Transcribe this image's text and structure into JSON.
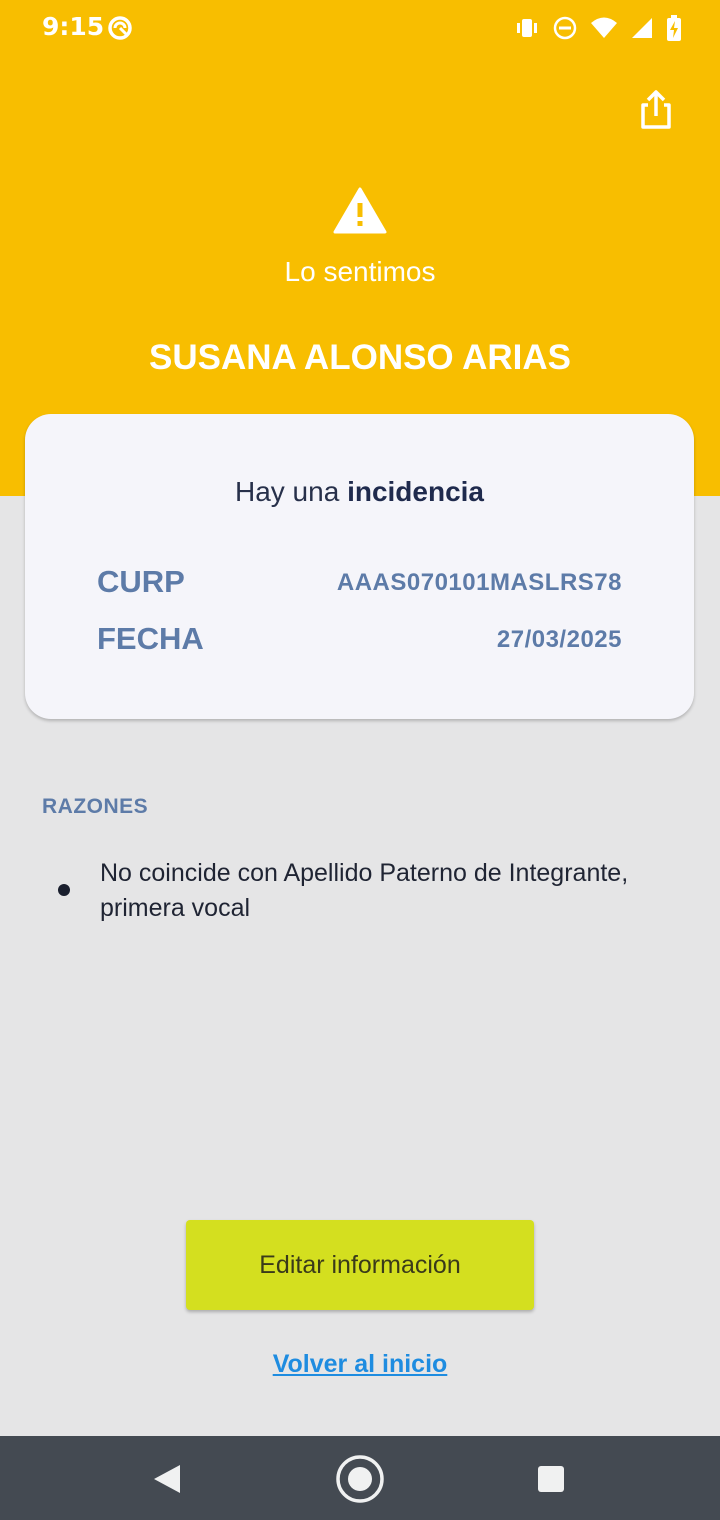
{
  "status_bar": {
    "time": "9:15",
    "icons": [
      "sync-icon",
      "vibrate-icon",
      "do-not-disturb-icon",
      "wifi-icon",
      "signal-icon",
      "battery-charging-icon"
    ]
  },
  "header": {
    "share_icon": "share-icon",
    "warning_icon": "warning-icon",
    "subtitle": "Lo sentimos",
    "name": "SUSANA ALONSO ARIAS",
    "background_color": "#f8be00"
  },
  "card": {
    "title_prefix": "Hay una ",
    "title_emphasis": "incidencia",
    "rows": [
      {
        "label": "CURP",
        "value": "AAAS070101MASLRS78"
      },
      {
        "label": "FECHA",
        "value": "27/03/2025"
      }
    ]
  },
  "reasons": {
    "label": "RAZONES",
    "items": [
      "No coincide con Apellido Paterno de Integrante, primera vocal"
    ]
  },
  "actions": {
    "edit_label": "Editar información",
    "edit_color": "#d4df1f",
    "back_label": "Volver al inicio",
    "link_color": "#1e8ce0"
  },
  "nav_bar": {
    "buttons": [
      "back-icon",
      "home-icon",
      "recents-icon"
    ]
  }
}
